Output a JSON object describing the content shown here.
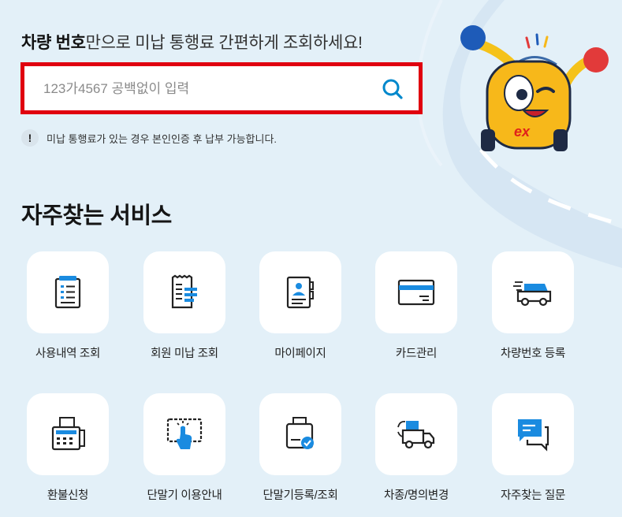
{
  "headline": {
    "bold": "차량 번호",
    "rest": "만으로 미납 통행료 간편하게 조회하세요!"
  },
  "search": {
    "placeholder": "123가4567 공백없이 입력",
    "value": "",
    "button_icon": "search-icon"
  },
  "notice": {
    "icon": "exclamation-icon",
    "text": "미납 통행료가 있는 경우 본인인증 후 납부 가능합니다."
  },
  "mascot": {
    "badge_text": "ex"
  },
  "services": {
    "title": "자주찾는 서비스",
    "items": [
      {
        "label": "사용내역 조회",
        "icon": "usage-history-icon"
      },
      {
        "label": "회원 미납 조회",
        "icon": "receipt-icon"
      },
      {
        "label": "마이페이지",
        "icon": "profile-card-icon"
      },
      {
        "label": "카드관리",
        "icon": "credit-card-icon"
      },
      {
        "label": "차량번호 등록",
        "icon": "car-register-icon"
      },
      {
        "label": "환불신청",
        "icon": "refund-icon"
      },
      {
        "label": "단말기 이용안내",
        "icon": "touch-terminal-icon"
      },
      {
        "label": "단말기등록/조회",
        "icon": "terminal-register-icon"
      },
      {
        "label": "차종/명의변경",
        "icon": "truck-change-icon"
      },
      {
        "label": "자주찾는 질문",
        "icon": "chat-faq-icon"
      }
    ]
  },
  "colors": {
    "accent": "#0088cc",
    "highlight": "#e0000f",
    "background": "#e3f0f8"
  }
}
